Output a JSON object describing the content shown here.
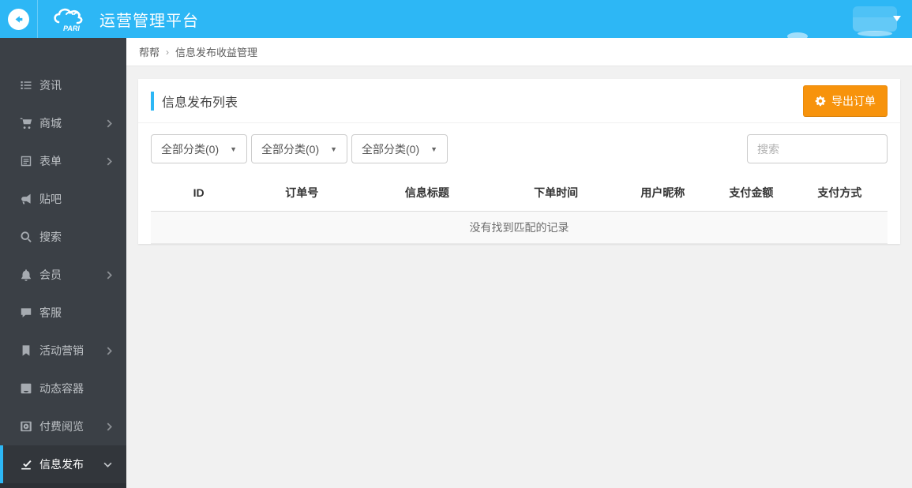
{
  "header": {
    "brand_title": "运营管理平台",
    "logo_text": "PARI"
  },
  "breadcrumb": {
    "items": [
      "帮帮",
      "信息发布收益管理"
    ],
    "separator": "›"
  },
  "sidebar": {
    "items": [
      {
        "label": "资讯",
        "icon": "list-icon",
        "expandable": false,
        "active": false
      },
      {
        "label": "商城",
        "icon": "cart-icon",
        "expandable": true,
        "active": false
      },
      {
        "label": "表单",
        "icon": "form-icon",
        "expandable": true,
        "active": false
      },
      {
        "label": "贴吧",
        "icon": "bullhorn-icon",
        "expandable": false,
        "active": false
      },
      {
        "label": "搜索",
        "icon": "search-icon",
        "expandable": false,
        "active": false
      },
      {
        "label": "会员",
        "icon": "bell-icon",
        "expandable": true,
        "active": false
      },
      {
        "label": "客服",
        "icon": "comment-icon",
        "expandable": false,
        "active": false
      },
      {
        "label": "活动营销",
        "icon": "bookmark-icon",
        "expandable": true,
        "active": false
      },
      {
        "label": "动态容器",
        "icon": "container-icon",
        "expandable": false,
        "active": false
      },
      {
        "label": "付费阅览",
        "icon": "paid-reading-icon",
        "expandable": true,
        "active": false
      },
      {
        "label": "信息发布",
        "icon": "publish-icon",
        "expandable": true,
        "active": true,
        "expanded": true
      }
    ]
  },
  "panel": {
    "title": "信息发布列表",
    "export_button": "导出订单",
    "filters": [
      "全部分类(0)",
      "全部分类(0)",
      "全部分类(0)"
    ],
    "search_placeholder": "搜索",
    "table": {
      "columns": [
        "ID",
        "订单号",
        "信息标题",
        "下单时间",
        "用户昵称",
        "支付金额",
        "支付方式"
      ],
      "empty_text": "没有找到匹配的记录"
    }
  },
  "icons": {
    "select_caret": "▼"
  },
  "colors": {
    "header_blue": "#2db7f5",
    "accent_blue": "#2db7f5",
    "export_orange": "#f7930c",
    "sidebar_bg": "#3b4046",
    "sidebar_active_bg": "#32363b",
    "page_bg": "#f1f1f1",
    "empty_row_bg": "#f9f9f9"
  }
}
